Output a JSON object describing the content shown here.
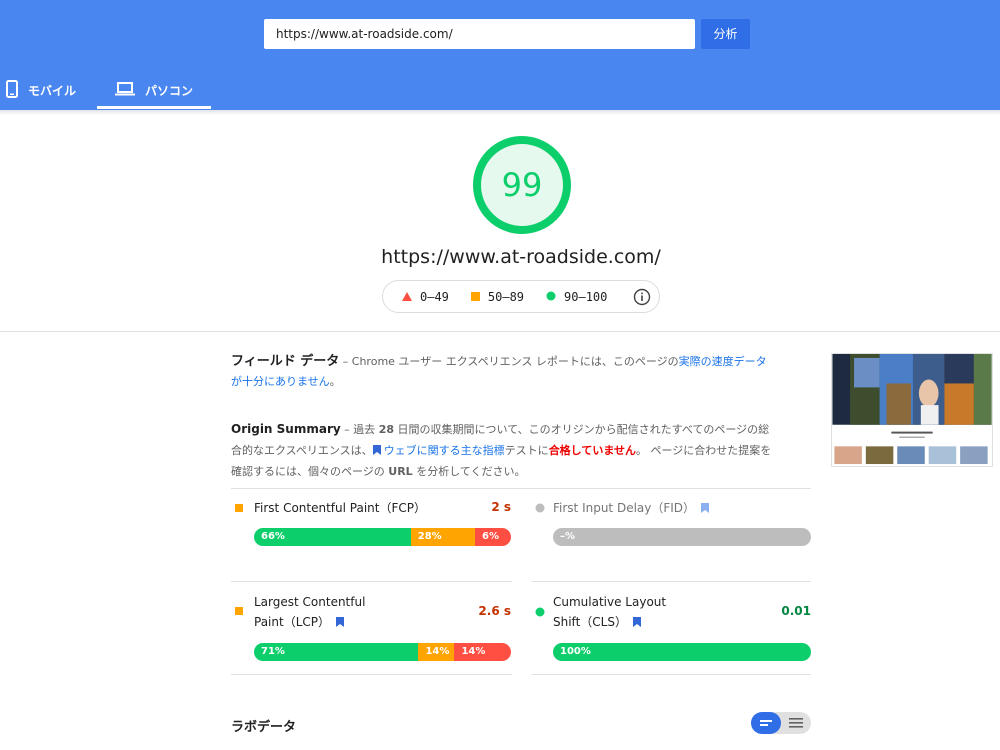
{
  "header": {
    "url_value": "https://www.at-roadside.com/",
    "analyze_label": "分析",
    "tabs": [
      {
        "label": "モバイル",
        "icon": "phone-icon",
        "active": false
      },
      {
        "label": "パソコン",
        "icon": "laptop-icon",
        "active": true
      }
    ]
  },
  "score": {
    "value": "99",
    "color": "#0cce6b",
    "page_url": "https://www.at-roadside.com/"
  },
  "legend": {
    "poor": "0–49",
    "average": "50–89",
    "good": "90–100",
    "colors": {
      "poor": "#ff4e42",
      "average": "#ffa400",
      "good": "#0cce6b"
    }
  },
  "field_data": {
    "title": "フィールド データ",
    "text_before": " – Chrome ユーザー エクスペリエンス レポートには、このページの",
    "link": "実際の速度データが十分にありません",
    "text_after": "。"
  },
  "origin_summary": {
    "title": "Origin Summary",
    "text_1": " – 過去 ",
    "days": "28",
    "text_2": " 日間の収集期間について、このオリジンから配信されたすべてのページの総合的なエクスペリエンスは、",
    "link": "ウェブに関する主な指標",
    "text_3": "テストに",
    "fail": "合格していません",
    "text_4": "。 ページに合わせた提案を確認するには、個々のページの ",
    "url_word": "URL",
    "text_5": " を分析してください。"
  },
  "metrics": {
    "fcp": {
      "name": "First Contentful Paint（FCP）",
      "value": "2 s",
      "status_color": "#ffa400",
      "value_color": "#c33300",
      "segments": [
        {
          "label": "66%",
          "pct": 66
        },
        {
          "label": "28%",
          "pct": 28
        },
        {
          "label": "6%",
          "pct": 6
        }
      ]
    },
    "fid": {
      "name": "First Input Delay（FID）",
      "value": "",
      "status_color": "#bdbdbd",
      "segments": [
        {
          "label": "–%",
          "pct": 100
        }
      ]
    },
    "lcp": {
      "name_line1": "Largest Contentful",
      "name_line2": "Paint（LCP）",
      "value": "2.6 s",
      "status_color": "#ffa400",
      "value_color": "#c33300",
      "segments": [
        {
          "label": "71%",
          "pct": 71
        },
        {
          "label": "14%",
          "pct": 14
        },
        {
          "label": "14%",
          "pct": 15
        }
      ]
    },
    "cls": {
      "name_line1": "Cumulative Layout",
      "name_line2": "Shift（CLS）",
      "value": "0.01",
      "status_color": "#0cce6b",
      "value_color": "#018642",
      "segments": [
        {
          "label": "100%",
          "pct": 100
        }
      ]
    }
  },
  "lab_data": {
    "title": "ラボデータ"
  }
}
